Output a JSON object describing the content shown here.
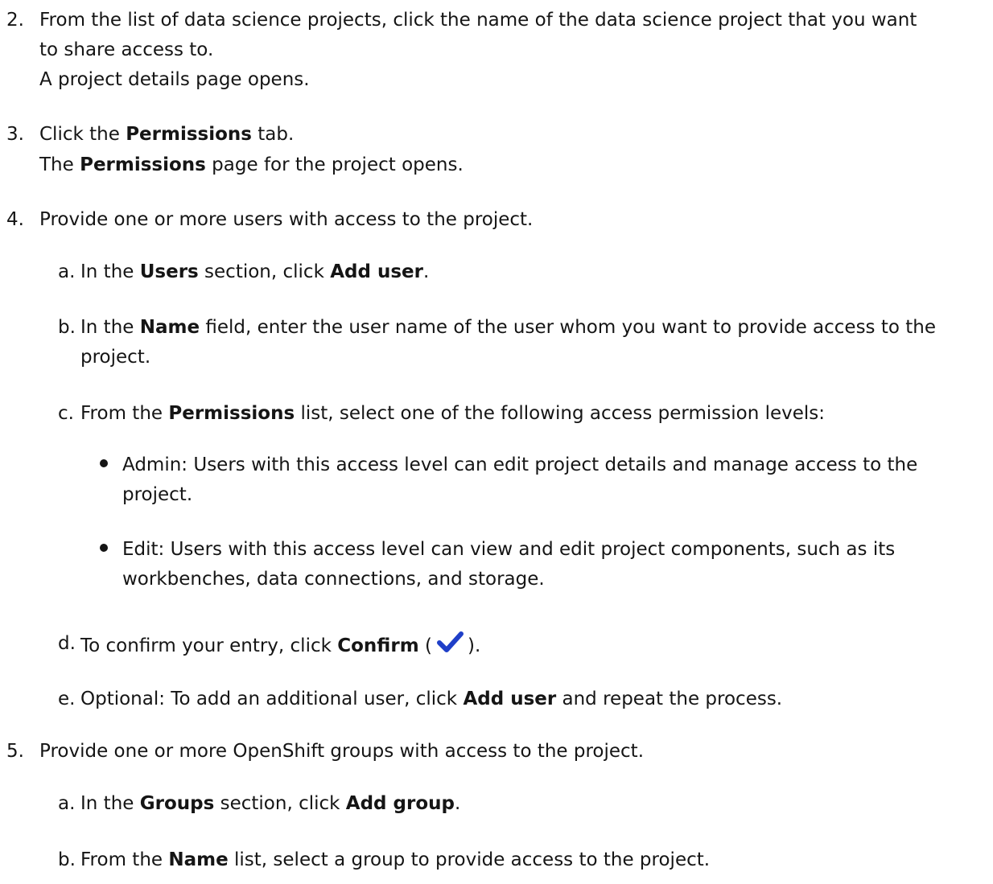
{
  "steps": [
    {
      "num": "2.",
      "lines": [
        "From the list of data science projects, click the name of the data science project that you want",
        "to share access to."
      ],
      "result": "A project details page opens."
    },
    {
      "num": "3.",
      "pre": "Click the ",
      "bold": "Permissions",
      "post": " tab.",
      "result_pre": "The ",
      "result_bold": "Permissions",
      "result_post": " page for the project opens."
    },
    {
      "num": "4.",
      "text": "Provide one or more users with access to the project.",
      "substeps": [
        {
          "letter": "a.",
          "pre": "In the ",
          "b1": "Users",
          "mid": " section, click ",
          "b2": "Add user",
          "post": "."
        },
        {
          "letter": "b.",
          "pre": "In the ",
          "b1": "Name",
          "post": " field, enter the user name of the user whom you want to provide access to the",
          "line2": "project."
        },
        {
          "letter": "c.",
          "pre": "From the ",
          "b1": "Permissions",
          "post": " list, select one of the following access permission levels:",
          "bullets": [
            {
              "line1": "Admin: Users with this access level can edit project details and manage access to the",
              "line2": "project."
            },
            {
              "line1": "Edit: Users with this access level can view and edit project components, such as its",
              "line2": "workbenches, data connections, and storage."
            }
          ]
        },
        {
          "letter": "d.",
          "pre": "To confirm your entry, click ",
          "b1": "Confirm",
          "open": " (",
          "close": ")."
        },
        {
          "letter": "e.",
          "pre": "Optional: To add an additional user, click ",
          "b1": "Add user",
          "post": " and repeat the process."
        }
      ]
    },
    {
      "num": "5.",
      "text": "Provide one or more OpenShift groups with access to the project.",
      "substeps": [
        {
          "letter": "a.",
          "pre": "In the ",
          "b1": "Groups",
          "mid": " section, click ",
          "b2": "Add group",
          "post": "."
        },
        {
          "letter": "b.",
          "pre": "From the ",
          "b1": "Name",
          "post": " list, select a group to provide access to the project."
        }
      ]
    }
  ],
  "colors": {
    "text": "#151515",
    "check": "#1f3fc8"
  },
  "icons": {
    "confirm": "checkmark-icon"
  }
}
